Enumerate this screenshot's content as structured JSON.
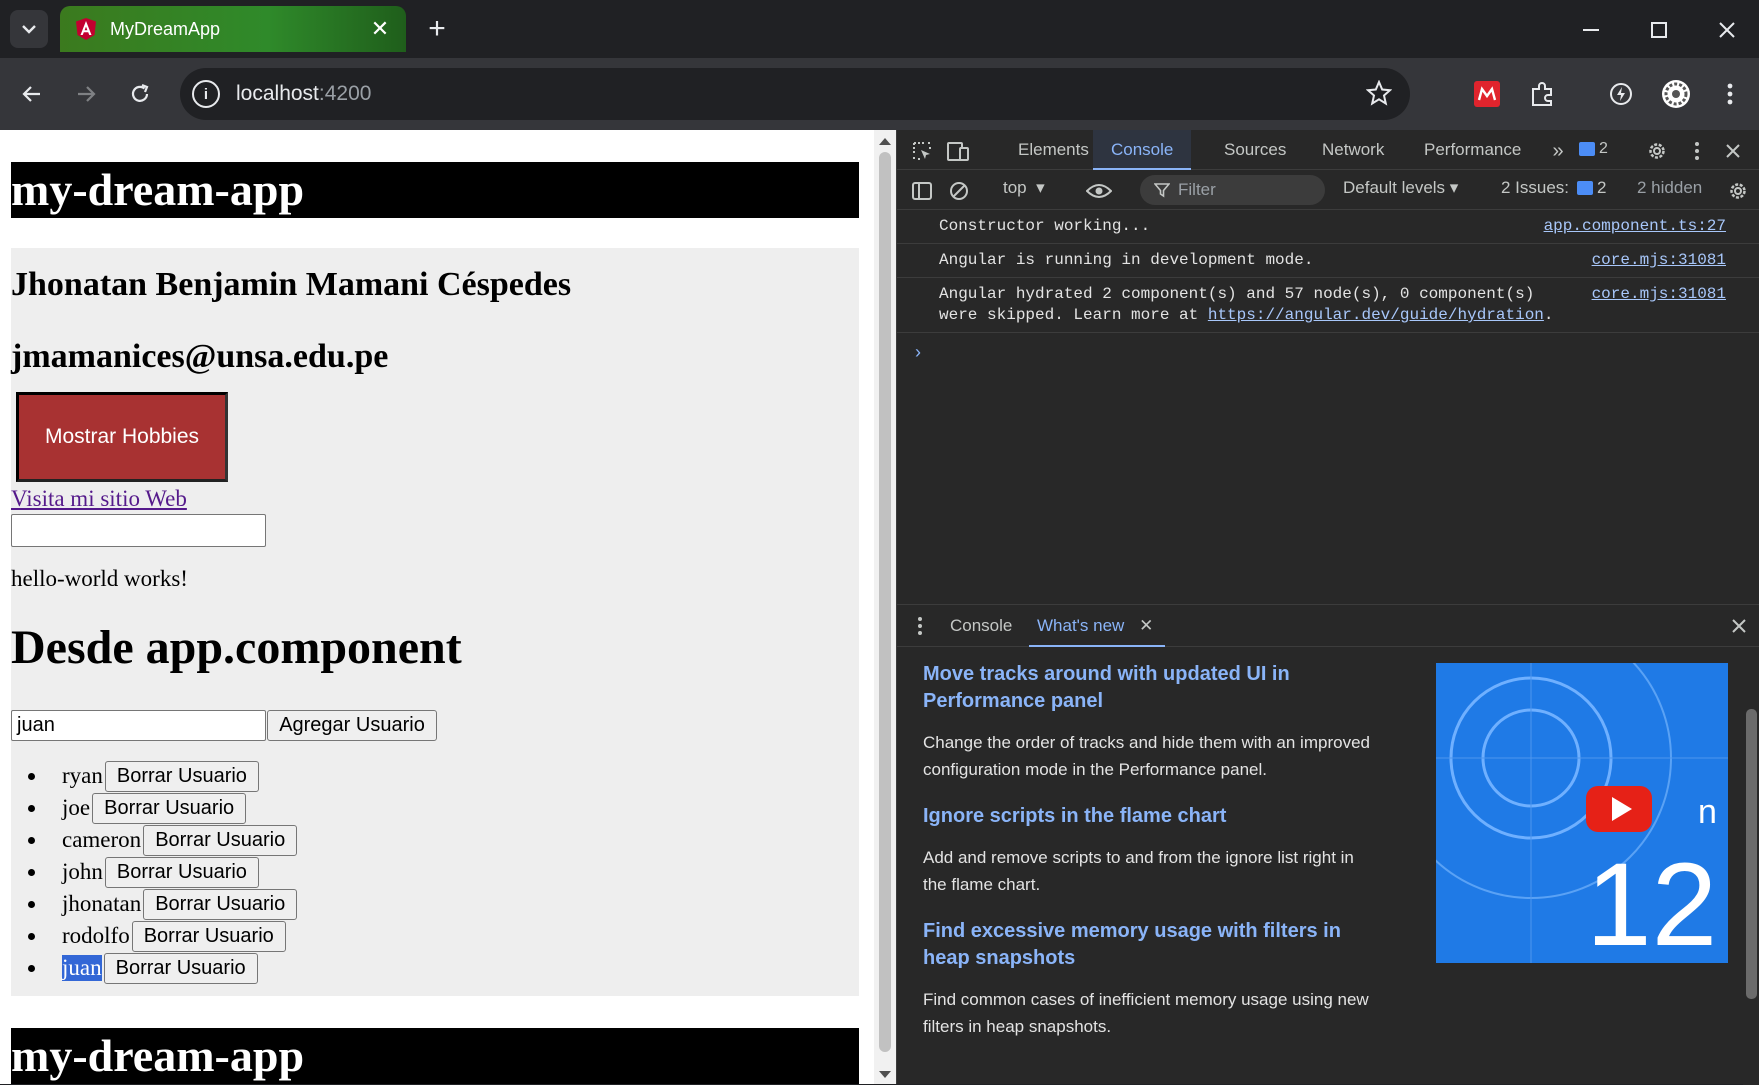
{
  "browser": {
    "tab_title": "MyDreamApp",
    "url_host": "localhost",
    "url_port": ":4200"
  },
  "page": {
    "header_title": "my-dream-app",
    "name": "Jhonatan Benjamin Mamani Céspedes",
    "email": "jmamanices@unsa.edu.pe",
    "hobbies_button": "Mostrar Hobbies",
    "site_link": "Visita mi sitio Web",
    "empty_input_value": "",
    "hello_text": "hello-world works!",
    "section_title": "Desde app.component",
    "user_input_value": "juan",
    "add_button": "Agregar Usuario",
    "delete_button": "Borrar Usuario",
    "users": [
      "ryan",
      "joe",
      "cameron",
      "john",
      "jhonatan",
      "rodolfo",
      "juan"
    ],
    "footer_header_title": "my-dream-app"
  },
  "devtools": {
    "tabs": [
      "Elements",
      "Console",
      "Sources",
      "Network",
      "Performance"
    ],
    "active_tab": "Console",
    "issues_badge": "2",
    "context": "top",
    "filter_placeholder": "Filter",
    "levels": "Default levels",
    "issues_label": "2 Issues:",
    "issues_count": "2",
    "hidden_count": "2 hidden",
    "logs": [
      {
        "msg": "Constructor working...",
        "src": "app.component.ts:27"
      },
      {
        "msg": "Angular is running in development mode.",
        "src": "core.mjs:31081"
      },
      {
        "msg_a": "Angular hydrated 2 component(s) and 57 node(s), 0 component(s)",
        "msg_b": "were skipped. Learn more at ",
        "link": "https://angular.dev/guide/hydration",
        "tail": ".",
        "src": "core.mjs:31081"
      }
    ],
    "drawer": {
      "tabs": [
        "Console",
        "What's new"
      ],
      "active_tab": "What's new",
      "items": [
        {
          "title": "Move tracks around with updated UI in Performance panel",
          "body": "Change the order of tracks and hide them with an improved configuration mode in the Performance panel."
        },
        {
          "title": "Ignore scripts in the flame chart",
          "body": "Add and remove scripts to and from the ignore list right in the flame chart."
        },
        {
          "title": "Find excessive memory usage with filters in heap snapshots",
          "body": "Find common cases of inefficient memory usage using new filters in heap snapshots."
        }
      ],
      "video_text": "12"
    }
  },
  "colors": {
    "tab_green": "#2f8a2a",
    "hobbies_button": "#a83232",
    "devtools_accent": "#8ab4f8",
    "selection": "#3367d6"
  }
}
